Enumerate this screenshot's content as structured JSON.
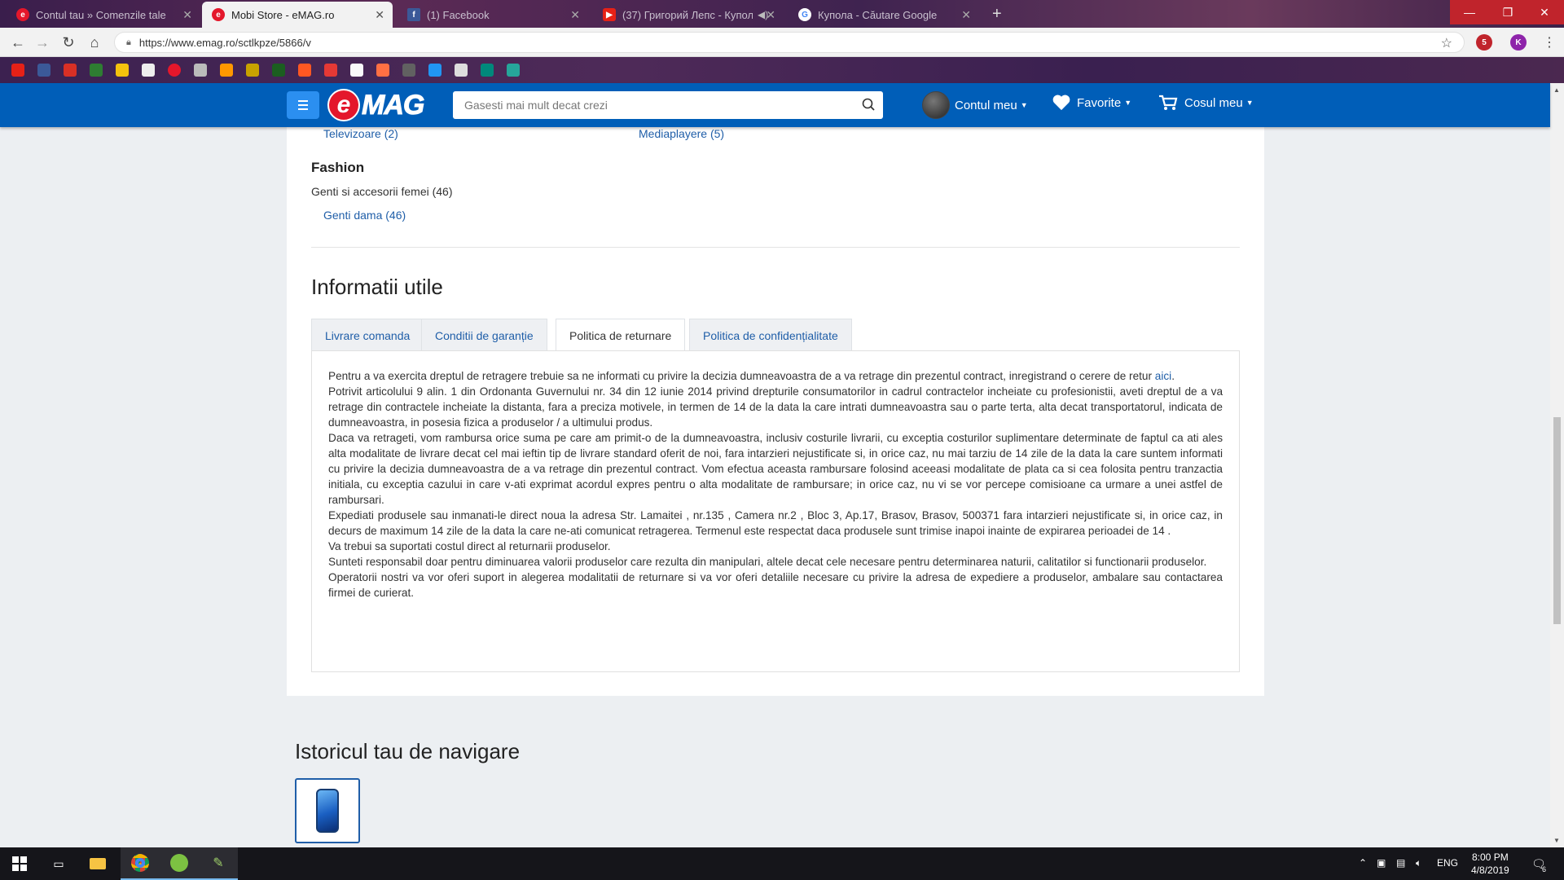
{
  "browser": {
    "tabs": [
      {
        "title": "Contul tau » Comenzile tale",
        "favicon": "emag-favicon",
        "active": false
      },
      {
        "title": "Mobi Store - eMAG.ro",
        "favicon": "emag-favicon",
        "active": true
      },
      {
        "title": "(1) Facebook",
        "favicon": "facebook-favicon",
        "active": false
      },
      {
        "title": "(37) Григорий Лепс - Купол",
        "favicon": "youtube-favicon",
        "active": false
      },
      {
        "title": "Купола - Căutare Google",
        "favicon": "google-favicon",
        "active": false
      }
    ],
    "url": "https://www.emag.ro/sctlkpze/5866/v",
    "profile_initial": "K",
    "extension_badge": "5"
  },
  "header": {
    "logo_e": "e",
    "logo_rest": "MAG",
    "search_placeholder": "Gasesti mai mult decat crezi",
    "account_label": "Contul meu",
    "favorites_label": "Favorite",
    "cart_label": "Cosul meu"
  },
  "categories": {
    "partial_links": [
      "Televizoare (2)",
      "Mediaplayere (5)"
    ],
    "fashion_heading": "Fashion",
    "fashion_sub": "Genti si accesorii femei (46)",
    "fashion_link": "Genti dama (46)"
  },
  "info": {
    "title": "Informatii utile",
    "tabs": [
      "Livrare comanda",
      "Conditii de garanție",
      "Politica de returnare",
      "Politica de confidențialitate"
    ],
    "active_tab": "Politica de returnare",
    "paragraphs": [
      "Pentru a va exercita dreptul de retragere trebuie sa ne informati cu privire la decizia dumneavoastra de a va retrage din prezentul contract, inregistrand o cerere de retur",
      "Potrivit articolului 9 alin. 1 din Ordonanta Guvernului nr. 34 din 12 iunie 2014 privind drepturile consumatorilor in cadrul contractelor incheiate cu profesionistii, aveti dreptul de a va retrage din contractele incheiate la distanta, fara a preciza motivele, in termen de 14 de la data la care intrati dumneavoastra sau o parte terta, alta decat transportatorul, indicata de dumneavoastra, in posesia fizica a produselor / a ultimului produs.",
      "Daca va retrageti, vom rambursa orice suma pe care am primit-o de la dumneavoastra, inclusiv costurile livrarii, cu exceptia costurilor suplimentare determinate de faptul ca ati ales alta modalitate de livrare decat cel mai ieftin tip de livrare standard oferit de noi, fara intarzieri nejustificate si, in orice caz, nu mai tarziu de 14 zile de la data la care suntem informati cu privire la decizia dumneavoastra de a va retrage din prezentul contract. Vom efectua aceasta rambursare folosind aceeasi modalitate de plata ca si cea folosita pentru tranzactia initiala, cu exceptia cazului in care v-ati exprimat acordul expres pentru o alta modalitate de rambursare; in orice caz, nu vi se vor percepe comisioane ca urmare a unei astfel de rambursari.",
      "Expediati produsele sau inmanati-le direct noua la adresa Str. Lamaitei , nr.135 , Camera nr.2 , Bloc 3, Ap.17, Brasov, Brasov, 500371 fara intarzieri nejustificate si, in orice caz, in decurs de maximum 14 zile de la data la care ne-ati comunicat retragerea. Termenul este respectat daca produsele sunt trimise inapoi inainte de expirarea perioadei de 14 .",
      "Va trebui sa suportati costul direct al returnarii produselor.",
      "Sunteti responsabil doar pentru diminuarea valorii produselor care rezulta din manipulari, altele decat cele necesare pentru determinarea naturii, calitatilor si functionarii produselor.",
      "Operatorii nostri va vor oferi suport in alegerea modalitatii de returnare si va vor oferi detaliile necesare cu privire la adresa de expediere a produselor, ambalare sau contactarea firmei de curierat."
    ],
    "link_text": "aici"
  },
  "history": {
    "title": "Istoricul tau de navigare"
  },
  "taskbar": {
    "language": "ENG",
    "time": "8:00 PM",
    "date": "4/8/2019",
    "notifications": "6"
  },
  "colors": {
    "emag_blue": "#005eb8",
    "emag_red": "#e4172b",
    "link_blue": "#1f5ea8"
  }
}
